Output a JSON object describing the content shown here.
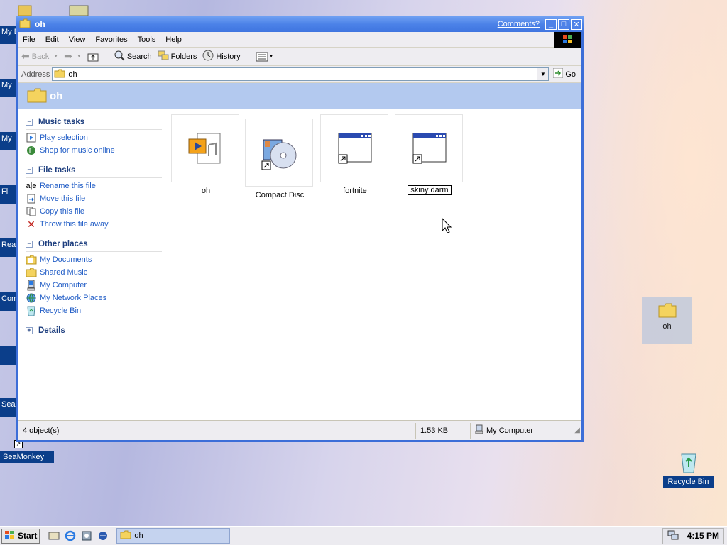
{
  "desktop": {
    "left_labels": [
      "My D",
      "My",
      "My",
      "Fi",
      "Read",
      "Com",
      "",
      "Sea"
    ],
    "icons": [
      {
        "label": "oh",
        "selected": true
      },
      {
        "label": "SeaMonkey",
        "selected": false
      },
      {
        "label": "Recycle Bin",
        "selected": false
      }
    ]
  },
  "window": {
    "title": "oh",
    "comments_link": "Comments?",
    "menu": [
      "File",
      "Edit",
      "View",
      "Favorites",
      "Tools",
      "Help"
    ],
    "toolbar": {
      "back": "Back",
      "search": "Search",
      "folders": "Folders",
      "history": "History"
    },
    "address": {
      "label": "Address",
      "value": "oh",
      "go": "Go"
    },
    "folder_heading": "oh"
  },
  "taskpane": {
    "music_tasks": {
      "title": "Music tasks",
      "items": [
        "Play selection",
        "Shop for music online"
      ]
    },
    "file_tasks": {
      "title": "File tasks",
      "items": [
        "Rename this file",
        "Move this file",
        "Copy this file",
        "Throw this file away"
      ]
    },
    "other_places": {
      "title": "Other places",
      "items": [
        "My Documents",
        "Shared Music",
        "My Computer",
        "My Network Places",
        "Recycle Bin"
      ]
    },
    "details": {
      "title": "Details"
    }
  },
  "files": [
    {
      "name": "oh",
      "icon": "media-file-icon"
    },
    {
      "name": "Compact Disc",
      "icon": "cd-shortcut-icon"
    },
    {
      "name": "fortnite",
      "icon": "program-shortcut-icon"
    },
    {
      "name": "skiny darm",
      "icon": "program-shortcut-icon",
      "renaming": true
    }
  ],
  "statusbar": {
    "objects": "4 object(s)",
    "size": "1.53 KB",
    "location": "My Computer"
  },
  "taskbar": {
    "start": "Start",
    "task": "oh",
    "clock": "4:15 PM"
  },
  "colors": {
    "title_blue": "#3c6ed8",
    "link_blue": "#215dc6",
    "heading_blue": "#1e3f7f",
    "desktop_label": "#0b3e8a"
  }
}
